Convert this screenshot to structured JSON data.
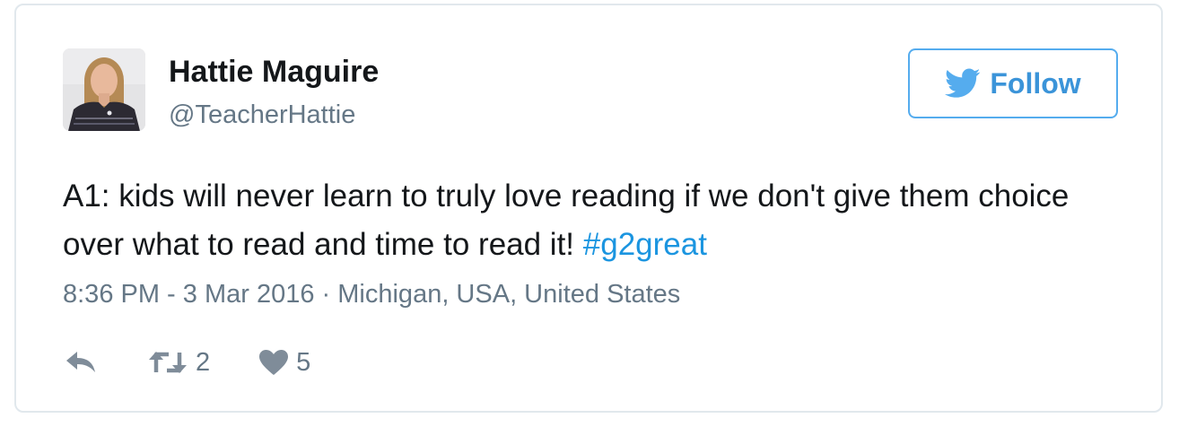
{
  "author": {
    "name": "Hattie Maguire",
    "handle": "@TeacherHattie"
  },
  "follow_button": {
    "label": "Follow",
    "icon": "twitter-bird-icon"
  },
  "tweet": {
    "text": "A1: kids will never learn to truly love reading if we don't give them choice over what to read and time to read it! ",
    "hashtag": "#g2great"
  },
  "meta": {
    "timestamp": "8:36 PM - 3 Mar 2016",
    "separator": " · ",
    "location": "Michigan, USA, United States"
  },
  "actions": {
    "reply_icon": "reply-icon",
    "retweet_icon": "retweet-icon",
    "retweet_count": "2",
    "like_icon": "heart-icon",
    "like_count": "5"
  },
  "colors": {
    "accent": "#55acee",
    "link": "#1b95e0",
    "text": "#14171a",
    "muted": "#657786",
    "border": "#e1e8ed"
  }
}
